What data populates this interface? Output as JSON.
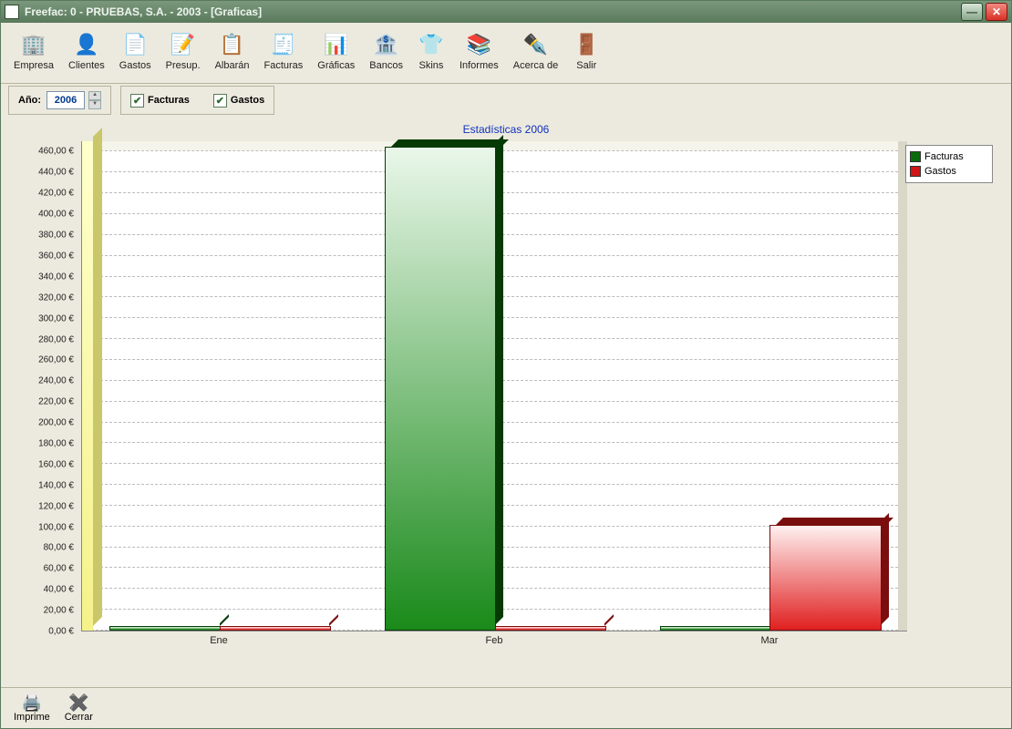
{
  "window": {
    "title": "Freefac: 0 - PRUEBAS, S.A. - 2003 - [Graficas]"
  },
  "toolbar": [
    {
      "id": "empresa",
      "label": "Empresa",
      "glyph": "🏢"
    },
    {
      "id": "clientes",
      "label": "Clientes",
      "glyph": "👤"
    },
    {
      "id": "gastos",
      "label": "Gastos",
      "glyph": "📄"
    },
    {
      "id": "presup",
      "label": "Presup.",
      "glyph": "📝"
    },
    {
      "id": "albaran",
      "label": "Albarán",
      "glyph": "📋"
    },
    {
      "id": "facturas",
      "label": "Facturas",
      "glyph": "🧾"
    },
    {
      "id": "graficas",
      "label": "Gráficas",
      "glyph": "📊"
    },
    {
      "id": "bancos",
      "label": "Bancos",
      "glyph": "🏦"
    },
    {
      "id": "skins",
      "label": "Skins",
      "glyph": "👕"
    },
    {
      "id": "informes",
      "label": "Informes",
      "glyph": "📚"
    },
    {
      "id": "acercade",
      "label": "Acerca de",
      "glyph": "✒️"
    },
    {
      "id": "salir",
      "label": "Salir",
      "glyph": "🚪"
    }
  ],
  "options": {
    "year_label": "Año:",
    "year_value": "2006",
    "facturas_checked": true,
    "facturas_label": "Facturas",
    "gastos_checked": true,
    "gastos_label": "Gastos"
  },
  "bottom_toolbar": [
    {
      "id": "imprime",
      "label": "Imprime",
      "glyph": "🖨️"
    },
    {
      "id": "cerrar",
      "label": "Cerrar",
      "glyph": "✖️"
    }
  ],
  "legend": [
    {
      "label": "Facturas",
      "color": "#0a6b0a"
    },
    {
      "label": "Gastos",
      "color": "#d01515"
    }
  ],
  "chart_data": {
    "type": "bar",
    "title": "Estadísticas 2006",
    "xlabel": "",
    "ylabel": "",
    "y_ticks": [
      0,
      20,
      40,
      60,
      80,
      100,
      120,
      140,
      160,
      180,
      200,
      220,
      240,
      260,
      280,
      300,
      320,
      340,
      360,
      380,
      400,
      420,
      440,
      460
    ],
    "y_tick_suffix": ",00 €",
    "ylim": [
      0,
      470
    ],
    "categories": [
      "Ene",
      "Feb",
      "Mar"
    ],
    "series": [
      {
        "name": "Facturas",
        "color_front": "linear-gradient(to bottom,#eaf7ea,#1a8a1a)",
        "color_side": "#053a05",
        "color_top": "#053a05",
        "values": [
          0,
          463,
          0
        ]
      },
      {
        "name": "Gastos",
        "color_front": "linear-gradient(to bottom,#fff0f0,#e02020)",
        "color_side": "#7a0d0d",
        "color_top": "#7a0d0d",
        "values": [
          0,
          0,
          100
        ]
      }
    ],
    "wall_bar": {
      "color_front": "linear-gradient(to bottom,#ffffcc,#f5f28a)",
      "color_side": "#c9c76a"
    }
  }
}
